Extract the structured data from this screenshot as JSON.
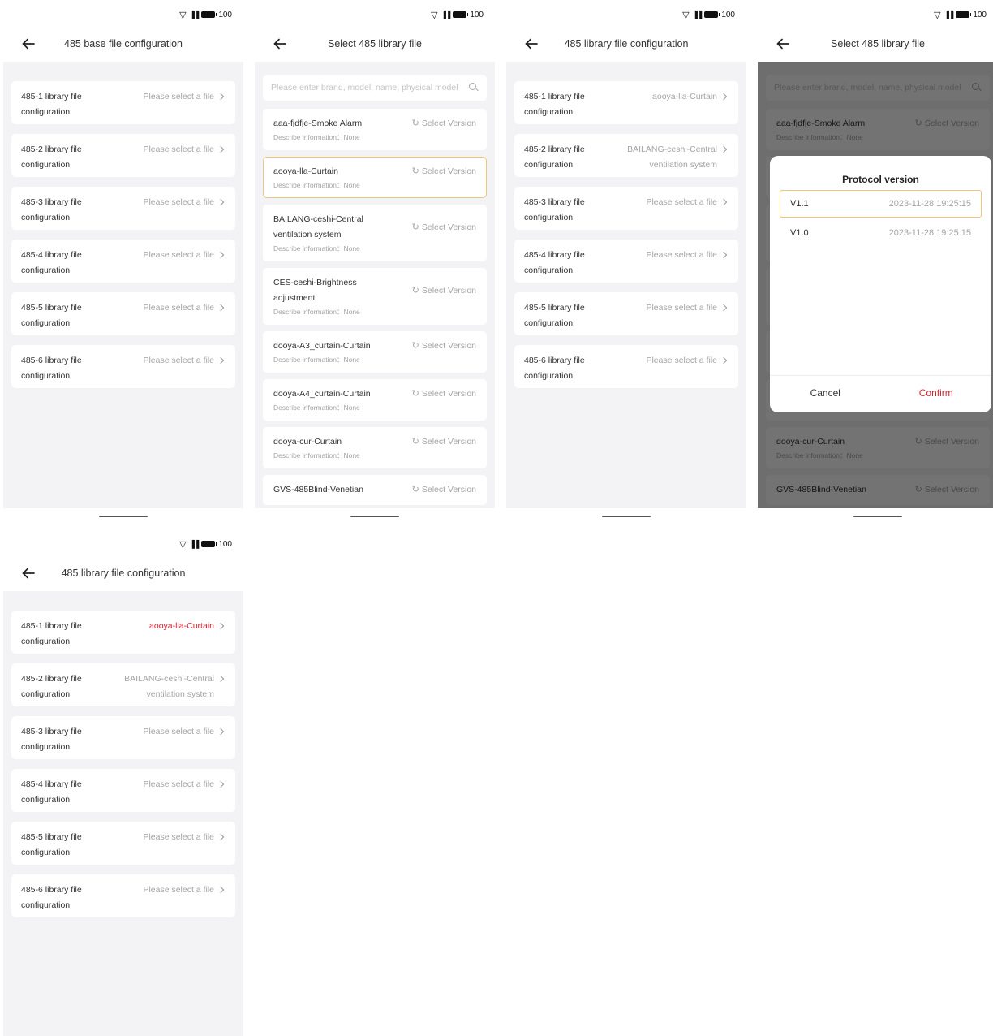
{
  "status": {
    "battery": "100"
  },
  "screens": {
    "s1": {
      "title": "485 base file configuration",
      "rows": [
        {
          "label": "485-1 library file configuration",
          "value": "Please select a file"
        },
        {
          "label": "485-2 library file configuration",
          "value": "Please select a file"
        },
        {
          "label": "485-3 library file configuration",
          "value": "Please select a file"
        },
        {
          "label": "485-4 library file configuration",
          "value": "Please select a file"
        },
        {
          "label": "485-5 library file configuration",
          "value": "Please select a file"
        },
        {
          "label": "485-6 library file configuration",
          "value": "Please select a file"
        }
      ]
    },
    "s2": {
      "title": "Select 485 library file",
      "search_placeholder": "Please enter brand, model, name, physical model",
      "version_label": "Select Version",
      "desc_label": "Describe information：None",
      "items": [
        {
          "name": "aaa-fjdfje-Smoke Alarm"
        },
        {
          "name": "aooya-lla-Curtain"
        },
        {
          "name": "BAILANG-ceshi-Central ventilation system"
        },
        {
          "name": "CES-ceshi-Brightness adjustment"
        },
        {
          "name": "dooya-A3_curtain-Curtain"
        },
        {
          "name": "dooya-A4_curtain-Curtain"
        },
        {
          "name": "dooya-cur-Curtain"
        },
        {
          "name": "GVS-485Blind-Venetian"
        }
      ]
    },
    "s3": {
      "title": "485 library file configuration",
      "rows": [
        {
          "label": "485-1 library file configuration",
          "value": "aooya-lla-Curtain"
        },
        {
          "label": "485-2 library file configuration",
          "value": "BAILANG-ceshi-Central ventilation system"
        },
        {
          "label": "485-3 library file configuration",
          "value": "Please select a file"
        },
        {
          "label": "485-4 library file configuration",
          "value": "Please select a file"
        },
        {
          "label": "485-5 library file configuration",
          "value": "Please select a file"
        },
        {
          "label": "485-6 library file configuration",
          "value": "Please select a file"
        }
      ]
    },
    "s4": {
      "title": "Select 485 library file",
      "dialog": {
        "title": "Protocol version",
        "versions": [
          {
            "version": "V1.1",
            "date": "2023-11-28 19:25:15"
          },
          {
            "version": "V1.0",
            "date": "2023-11-28 19:25:15"
          }
        ],
        "cancel": "Cancel",
        "confirm": "Confirm"
      }
    },
    "s5": {
      "title": "485 library file configuration",
      "rows": [
        {
          "label": "485-1 library file configuration",
          "value": "aooya-lla-Curtain"
        },
        {
          "label": "485-2 library file configuration",
          "value": "BAILANG-ceshi-Central ventilation system"
        },
        {
          "label": "485-3 library file configuration",
          "value": "Please select a file"
        },
        {
          "label": "485-4 library file configuration",
          "value": "Please select a file"
        },
        {
          "label": "485-5 library file configuration",
          "value": "Please select a file"
        },
        {
          "label": "485-6 library file configuration",
          "value": "Please select a file"
        }
      ]
    }
  },
  "colors": {
    "accent": "#d9232f",
    "highlight_border": "#f0c57c",
    "background": "#f3f3f6"
  }
}
